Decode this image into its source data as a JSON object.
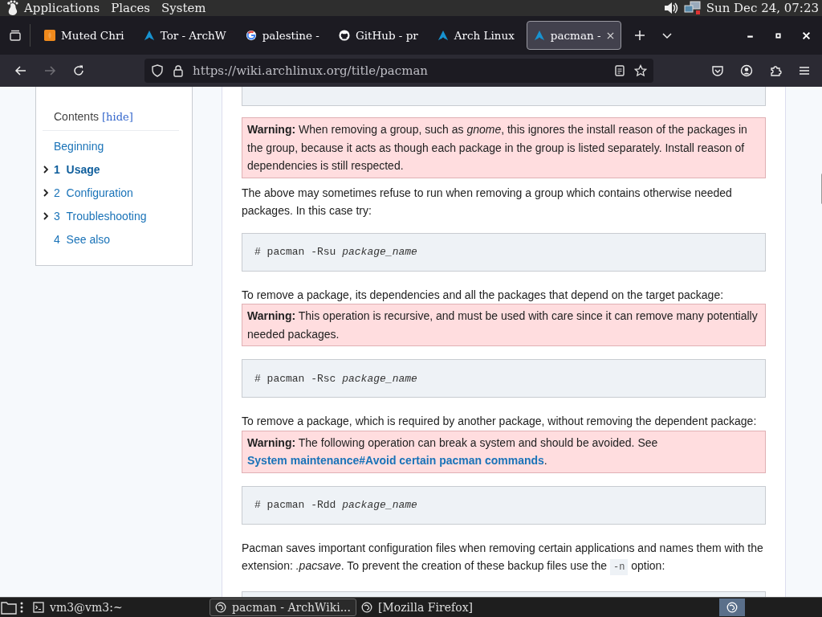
{
  "top_panel": {
    "menus": [
      "Applications",
      "Places",
      "System"
    ],
    "clock": "Sun Dec 24, 07:23"
  },
  "tabs": [
    {
      "title": "Muted Chri",
      "selected": false
    },
    {
      "title": "Tor - ArchW",
      "selected": false
    },
    {
      "title": "palestine -",
      "selected": false
    },
    {
      "title": "GitHub - pr",
      "selected": false
    },
    {
      "title": "Arch Linux",
      "selected": false
    },
    {
      "title": "pacman -",
      "selected": true
    }
  ],
  "navbar": {
    "url": "https://wiki.archlinux.org/title/pacman",
    "forward_disabled": true
  },
  "toc": {
    "title": "Contents",
    "toggle": "[hide]",
    "items": [
      {
        "label": "Beginning",
        "expandable": false,
        "selected": false
      },
      {
        "number": "1",
        "label": "Usage",
        "expandable": true,
        "selected": true
      },
      {
        "number": "2",
        "label": "Configuration",
        "expandable": true,
        "selected": false
      },
      {
        "number": "3",
        "label": "Troubleshooting",
        "expandable": true,
        "selected": false
      },
      {
        "number": "4",
        "label": "See also",
        "expandable": false,
        "selected": false
      }
    ]
  },
  "content": [
    {
      "kind": "warning",
      "parts": [
        {
          "kind": "text",
          "text": "**Warning:** When removing a group, such as *gnome*, this ignores the install reason of the packages in the group, because it acts as though each package in the group is listed separately. Install reason of dependencies is still respected."
        }
      ]
    },
    {
      "kind": "para",
      "parts": [
        {
          "kind": "text",
          "text": "The above may sometimes refuse to run when removing a group which contains otherwise needed packages. In this case try:"
        }
      ]
    },
    {
      "kind": "code",
      "text": "# pacman -Rsu *package_name*"
    },
    {
      "kind": "para",
      "parts": [
        {
          "kind": "text",
          "text": "To remove a package, its dependencies and all the packages that depend on the target package:"
        }
      ]
    },
    {
      "kind": "warning",
      "parts": [
        {
          "kind": "text",
          "text": "**Warning:** This operation is recursive, and must be used with care since it can remove many potentially needed packages."
        }
      ]
    },
    {
      "kind": "code",
      "text": "# pacman -Rsc *package_name*"
    },
    {
      "kind": "para",
      "parts": [
        {
          "kind": "text",
          "text": "To remove a package, which is required by another package, without removing the dependent package:"
        }
      ]
    },
    {
      "kind": "warning",
      "parts": [
        {
          "kind": "text",
          "text": "**Warning:** The following operation can break a system and should be avoided. See "
        },
        {
          "kind": "link",
          "text": "System maintenance#Avoid certain pacman commands"
        },
        {
          "kind": "text",
          "text": "."
        }
      ]
    },
    {
      "kind": "code",
      "text": "# pacman -Rdd *package_name*"
    },
    {
      "kind": "para",
      "parts": [
        {
          "kind": "text",
          "text": "Pacman saves important configuration files when removing certain applications and names them with the extension: *.pacsave*. To prevent the creation of these backup files use the "
        },
        {
          "kind": "code",
          "text": "-n"
        },
        {
          "kind": "text",
          "text": " option:"
        }
      ]
    }
  ],
  "taskbar": {
    "tasks": [
      {
        "label": "vm3@vm3:~",
        "selected": false
      },
      {
        "label": "pacman - ArchWiki...",
        "selected": true
      },
      {
        "label": "[Mozilla Firefox]",
        "selected": false
      }
    ]
  }
}
